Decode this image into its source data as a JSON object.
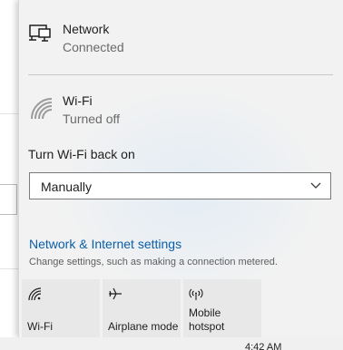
{
  "taskbar": {
    "clock": "4:42 AM"
  },
  "connections": [
    {
      "name": "Network",
      "status": "Connected",
      "icon": "ethernet-network-icon"
    },
    {
      "name": "Wi-Fi",
      "status": "Turned off",
      "icon": "wifi-off-icon"
    }
  ],
  "wifi_back_on": {
    "label": "Turn Wi-Fi back on",
    "selected": "Manually"
  },
  "settings": {
    "link": "Network & Internet settings",
    "description": "Change settings, such as making a connection metered."
  },
  "quick_actions": [
    {
      "label": "Wi-Fi",
      "icon": "wifi-icon"
    },
    {
      "label": "Airplane mode",
      "icon": "airplane-icon"
    },
    {
      "label_line1": "Mobile",
      "label_line2": "hotspot",
      "icon": "hotspot-icon"
    }
  ],
  "colors": {
    "panel_bg": "#f2f2f2",
    "link": "#0a5ea8",
    "tile_bg": "#e8e8e8"
  }
}
